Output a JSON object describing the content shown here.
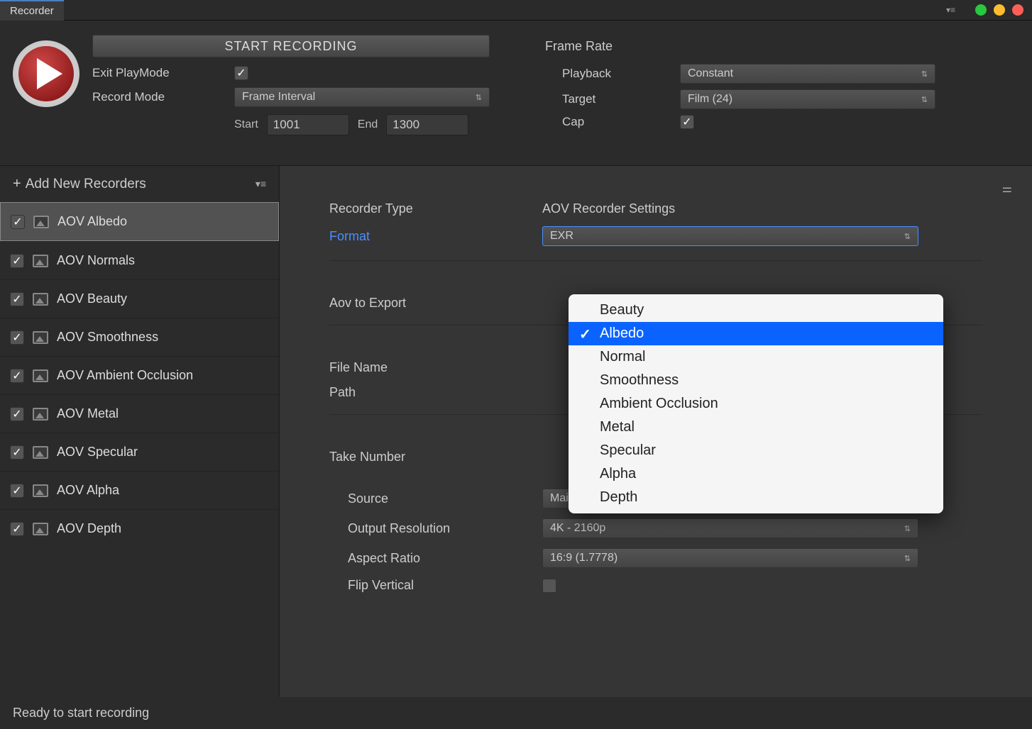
{
  "tab": {
    "title": "Recorder"
  },
  "header": {
    "start_button": "START RECORDING",
    "exit_playmode_label": "Exit PlayMode",
    "exit_playmode_checked": true,
    "record_mode_label": "Record Mode",
    "record_mode_value": "Frame Interval",
    "start_label": "Start",
    "start_value": "1001",
    "end_label": "End",
    "end_value": "1300"
  },
  "frame_rate": {
    "title": "Frame Rate",
    "playback_label": "Playback",
    "playback_value": "Constant",
    "target_label": "Target",
    "target_value": "Film (24)",
    "cap_label": "Cap",
    "cap_checked": true
  },
  "sidebar": {
    "add_label": "Add New Recorders",
    "items": [
      {
        "name": "AOV Albedo",
        "checked": true,
        "selected": true
      },
      {
        "name": "AOV Normals",
        "checked": true,
        "selected": false
      },
      {
        "name": "AOV Beauty",
        "checked": true,
        "selected": false
      },
      {
        "name": "AOV Smoothness",
        "checked": true,
        "selected": false
      },
      {
        "name": "AOV Ambient Occlusion",
        "checked": true,
        "selected": false
      },
      {
        "name": "AOV Metal",
        "checked": true,
        "selected": false
      },
      {
        "name": "AOV Specular",
        "checked": true,
        "selected": false
      },
      {
        "name": "AOV Alpha",
        "checked": true,
        "selected": false
      },
      {
        "name": "AOV Depth",
        "checked": true,
        "selected": false
      }
    ]
  },
  "details": {
    "recorder_type_label": "Recorder Type",
    "recorder_type_value": "AOV Recorder Settings",
    "format_label": "Format",
    "format_value": "EXR",
    "aov_export_label": "Aov to Export",
    "file_name_label": "File Name",
    "path_label": "Path",
    "take_number_label": "Take Number",
    "source_label": "Source",
    "source_value": "MainCamera",
    "output_res_label": "Output Resolution",
    "output_res_value": "4K - 2160p",
    "aspect_label": "Aspect Ratio",
    "aspect_value": "16:9 (1.7778)",
    "flip_label": "Flip Vertical",
    "flip_checked": false
  },
  "popup": {
    "options": [
      {
        "label": "Beauty",
        "selected": false
      },
      {
        "label": "Albedo",
        "selected": true
      },
      {
        "label": "Normal",
        "selected": false
      },
      {
        "label": "Smoothness",
        "selected": false
      },
      {
        "label": "Ambient Occlusion",
        "selected": false
      },
      {
        "label": "Metal",
        "selected": false
      },
      {
        "label": "Specular",
        "selected": false
      },
      {
        "label": "Alpha",
        "selected": false
      },
      {
        "label": "Depth",
        "selected": false
      }
    ]
  },
  "status": "Ready to start recording"
}
